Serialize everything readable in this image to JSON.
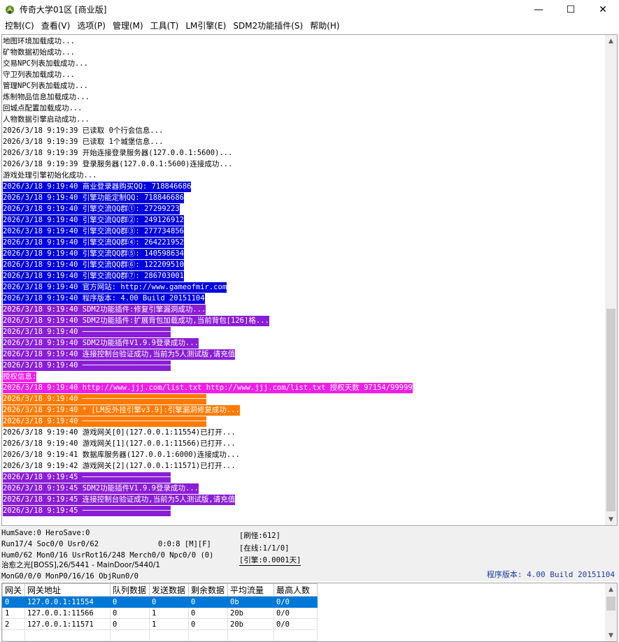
{
  "window": {
    "title": "传奇大学01区 [商业版]",
    "minimize": "—",
    "maximize": "☐",
    "close": "✕"
  },
  "menu": [
    "控制(C)",
    "查看(V)",
    "选项(P)",
    "管理(M)",
    "工具(T)",
    "LM引擎(E)",
    "SDM2功能插件(S)",
    "帮助(H)"
  ],
  "log": [
    {
      "text": "地图环境加载成功...",
      "style": "normal"
    },
    {
      "text": "矿物数据初始成功...",
      "style": "normal"
    },
    {
      "text": "交易NPC列表加载成功...",
      "style": "normal"
    },
    {
      "text": "守卫列表加载成功...",
      "style": "normal"
    },
    {
      "text": "管理NPC列表加载成功...",
      "style": "normal"
    },
    {
      "text": "炼制物品信息加载成功...",
      "style": "normal"
    },
    {
      "text": "回城点配置加载成功...",
      "style": "normal"
    },
    {
      "text": "人物数据引擎启动成功...",
      "style": "normal"
    },
    {
      "text": "2026/3/18 9:19:39 已读取 0个行会信息...",
      "style": "normal"
    },
    {
      "text": "2026/3/18 9:19:39 已读取 1个城堡信息...",
      "style": "normal"
    },
    {
      "text": "2026/3/18 9:19:39 开始连接登录服务器(127.0.0.1:5600)...",
      "style": "normal"
    },
    {
      "text": "2026/3/18 9:19:39 登录服务器(127.0.0.1:5600)连接成功...",
      "style": "normal"
    },
    {
      "text": "游戏处理引擎初始化成功...",
      "style": "normal"
    },
    {
      "text": "2026/3/18 9:19:40 商业登录器购买QQ: 718846686",
      "style": "blue"
    },
    {
      "text": "2026/3/18 9:19:40 引擎功能定制QQ: 718846686",
      "style": "blue"
    },
    {
      "text": "2026/3/18 9:19:40 引擎交流QQ群①: 27299223",
      "style": "blue"
    },
    {
      "text": "2026/3/18 9:19:40 引擎交流QQ群②: 249126912",
      "style": "blue"
    },
    {
      "text": "2026/3/18 9:19:40 引擎交流QQ群③: 277734856",
      "style": "blue"
    },
    {
      "text": "2026/3/18 9:19:40 引擎交流QQ群④: 264221952",
      "style": "blue"
    },
    {
      "text": "2026/3/18 9:19:40 引擎交流QQ群⑤: 140598634",
      "style": "blue"
    },
    {
      "text": "2026/3/18 9:19:40 引擎交流QQ群⑥: 122209510",
      "style": "blue"
    },
    {
      "text": "2026/3/18 9:19:40 引擎交流QQ群⑦: 286703001",
      "style": "blue"
    },
    {
      "text": "2026/3/18 9:19:40 官方网站: http://www.gameofmir.com",
      "style": "blue"
    },
    {
      "text": "2026/3/18 9:19:40 程序版本: 4.00 Build 20151104",
      "style": "blue"
    },
    {
      "text": "2026/3/18 9:19:40 SDM2功能插件:修复引擎漏洞成功...",
      "style": "purple"
    },
    {
      "text": "2026/3/18 9:19:40 SDM2功能插件:扩展背包加载成功,当前背包[126]格...",
      "style": "purple"
    },
    {
      "text": "2026/3/18 9:19:40 ────────────────────",
      "style": "purple"
    },
    {
      "text": "2026/3/18 9:19:40 SDM2功能插件V1.9.9登录成功...",
      "style": "purple"
    },
    {
      "text": "2026/3/18 9:19:40 连接控制台验证成功,当前为5人测试版,请充值",
      "style": "purple"
    },
    {
      "text": "2026/3/18 9:19:40 ────────────────────",
      "style": "purple"
    },
    {
      "text": "授权信息:",
      "style": "magenta"
    },
    {
      "text": "2026/3/18 9:19:40 http://www.jjj.com/list.txt http://www.jjj.com/list.txt 授权天数 97154/99999",
      "style": "magenta"
    },
    {
      "text": "2026/3/18 9:19:40 ────────────────────────────",
      "style": "orange"
    },
    {
      "text": "2026/3/18 9:19:40 * [LM反外挂引擎v3.9]:引擎漏洞修复成功...",
      "style": "orange"
    },
    {
      "text": "2026/3/18 9:19:40 ────────────────────────────",
      "style": "orange"
    },
    {
      "text": "2026/3/18 9:19:40 游戏网关[0](127.0.0.1:11554)已打开...",
      "style": "normal"
    },
    {
      "text": "2026/3/18 9:19:40 游戏网关[1](127.0.0.1:11566)已打开...",
      "style": "normal"
    },
    {
      "text": "2026/3/18 9:19:41 数据库服务器(127.0.0.1:6000)连接成功...",
      "style": "normal"
    },
    {
      "text": "2026/3/18 9:19:42 游戏网关[2](127.0.0.1:11571)已打开...",
      "style": "normal"
    },
    {
      "text": "2026/3/18 9:19:45 ────────────────────",
      "style": "purple"
    },
    {
      "text": "2026/3/18 9:19:45 SDM2功能插件V1.9.9登录成功...",
      "style": "purple"
    },
    {
      "text": "2026/3/18 9:19:45 连接控制台验证成功,当前为5人测试版,请充值",
      "style": "purple"
    },
    {
      "text": "2026/3/18 9:19:45 ────────────────────",
      "style": "purple"
    }
  ],
  "status": {
    "line1": "HumSave:0 HeroSave:0",
    "line2": "Run17/4 Soc0/0 Usr0/62",
    "time": "0:0:8 [M][F]",
    "line3": "Hum0/62 Mon0/16 UsrRot16/248 Merch0/0 Npc0/0 (0)",
    "line4": "治愈之光[BOSS],26/5441 - MainDoor/5440/1",
    "line5": "MonG0/0/0 MonP0/16/16 ObjRun0/0",
    "refresh": "[刷怪:612]",
    "online": "[在线:1/1/0]",
    "engine": "[引擎:0.0001天]",
    "version": "程序版本: 4.00 Build 20151104"
  },
  "gates": {
    "headers": [
      "网关",
      "网关地址",
      "队列数据",
      "发送数据",
      "剩余数据",
      "平均流量",
      "最高人数"
    ],
    "rows": [
      [
        "0",
        "127.0.0.1:11554",
        "0",
        "0",
        "0",
        "0b",
        "0/0"
      ],
      [
        "1",
        "127.0.0.1:11566",
        "0",
        "1",
        "0",
        "20b",
        "0/0"
      ],
      [
        "2",
        "127.0.0.1:11571",
        "0",
        "1",
        "0",
        "20b",
        "0/0"
      ]
    ]
  }
}
